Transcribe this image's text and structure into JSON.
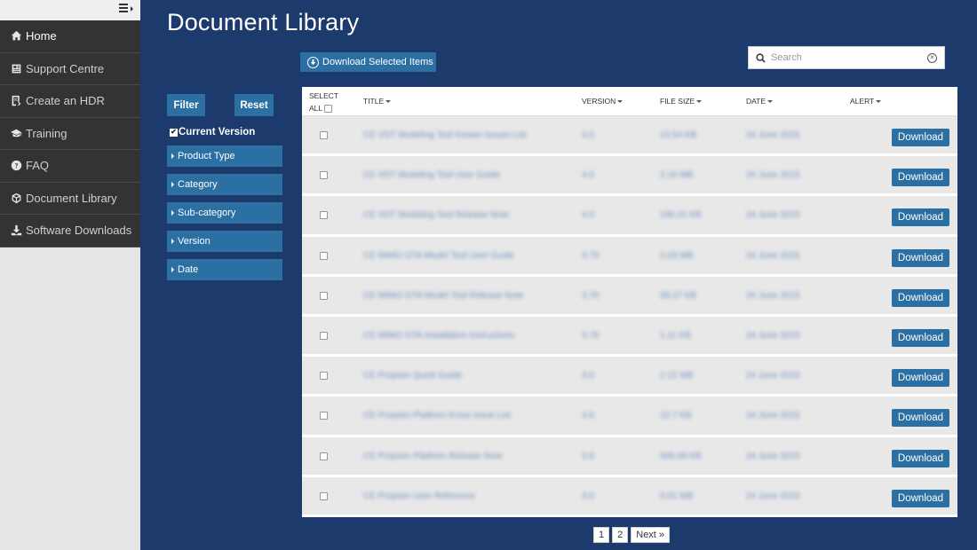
{
  "sidebar": {
    "items": [
      {
        "label": "Home",
        "icon": "home-icon"
      },
      {
        "label": "Support Centre",
        "icon": "newspaper-icon"
      },
      {
        "label": "Create an HDR",
        "icon": "form-icon"
      },
      {
        "label": "Training",
        "icon": "graduation-cap-icon"
      },
      {
        "label": "FAQ",
        "icon": "question-circle-icon"
      },
      {
        "label": "Document Library",
        "icon": "cubes-icon"
      },
      {
        "label": "Software Downloads",
        "icon": "download-icon"
      }
    ]
  },
  "header": {
    "title": "Document Library"
  },
  "toolbar": {
    "download_selected_label": "Download Selected Items"
  },
  "search": {
    "placeholder": "Search",
    "value": ""
  },
  "filters": {
    "filter_label": "Filter",
    "reset_label": "Reset",
    "current_version_label": "Current Version",
    "current_version_checked": true,
    "facets": [
      "Product Type",
      "Category",
      "Sub-category",
      "Version",
      "Date"
    ]
  },
  "table": {
    "headers": {
      "select_all_line1": "SELECT",
      "select_all_line2": "ALL",
      "title": "TITLE",
      "version": "VERSION",
      "file_size": "FILE SIZE",
      "date": "DATE",
      "alert": "ALERT"
    },
    "download_label": "Download",
    "rows": [
      {
        "title": "CE VDT Modeling Tool Known Issues List",
        "version": "4.0",
        "size": "13.54 KB",
        "date": "24 June 2015"
      },
      {
        "title": "CE VDT Modeling Tool User Guide",
        "version": "4.0",
        "size": "2.16 MB",
        "date": "24 June 2015"
      },
      {
        "title": "CE VDT Modeling Tool Release Note",
        "version": "4.0",
        "size": "230.21 KB",
        "date": "24 June 2015"
      },
      {
        "title": "CE MIMO OTA Model Tool User Guide",
        "version": "3.70",
        "size": "2.03 MB",
        "date": "24 June 2015"
      },
      {
        "title": "CE MIMO OTA Model Tool Release Note",
        "version": "3.70",
        "size": "58.27 KB",
        "date": "24 June 2015"
      },
      {
        "title": "CE MIMO OTA Installation Instructions",
        "version": "3.70",
        "size": "1.11 KB",
        "date": "24 June 2015"
      },
      {
        "title": "CE Propsim Quick Guide",
        "version": "3.6",
        "size": "2.12 MB",
        "date": "24 June 2015"
      },
      {
        "title": "CE Propsim Platform Know Issue List",
        "version": "3.6",
        "size": "22.7 KB",
        "date": "24 June 2015"
      },
      {
        "title": "CE Propsim Platform Release Note",
        "version": "3.6",
        "size": "505.09 KB",
        "date": "24 June 2015"
      },
      {
        "title": "CE Propsim User Reference",
        "version": "3.6",
        "size": "9.61 MB",
        "date": "24 June 2015"
      }
    ]
  },
  "pagination": {
    "pages": [
      "1",
      "2"
    ],
    "next_label": "Next »"
  }
}
